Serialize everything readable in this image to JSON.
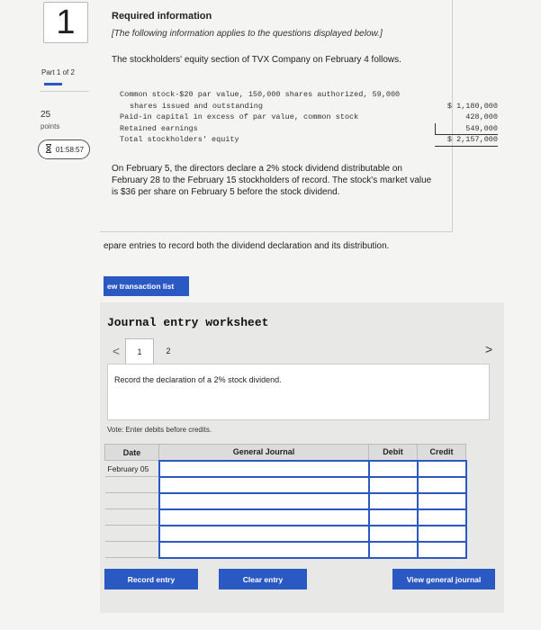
{
  "question": {
    "number": "1",
    "part": "Part 1 of 2",
    "points_value": "25",
    "points_label": "points",
    "timer": "01:58:57"
  },
  "required": {
    "title": "Required information",
    "subtitle": "[The following information applies to the questions displayed below.]",
    "intro": "The stockholders' equity section of TVX Company on February 4 follows."
  },
  "equity": {
    "rows": [
      {
        "label1": "Common stock-$20 par value, 150,000 shares authorized, 59,000",
        "label2": "shares issued and outstanding",
        "amount": "$ 1,180,000"
      },
      {
        "label1": "Paid-in capital in excess of par value, common stock",
        "amount": "428,000"
      },
      {
        "label1": "Retained earnings",
        "amount": "549,000"
      },
      {
        "label1": "Total stockholders' equity",
        "amount": "$ 2,157,000"
      }
    ]
  },
  "scenario": "On February 5, the directors declare a 2% stock dividend distributable on February 28 to the February 15 stockholders of record. The stock's market value is $36 per share on February 5 before the stock dividend.",
  "prepare": "epare entries to record both the dividend declaration and its distribution.",
  "view_transaction": "ew transaction list",
  "worksheet": {
    "title": "Journal entry worksheet",
    "tabs": [
      "1",
      "2"
    ],
    "prev_icon": "<",
    "next_icon": ">",
    "instruction": "Record the declaration of a 2% stock dividend.",
    "note": "Vote: Enter debits before credits.",
    "headers": {
      "date": "Date",
      "journal": "General Journal",
      "debit": "Debit",
      "credit": "Credit"
    },
    "rows": [
      {
        "date": "February 05"
      },
      {
        "date": ""
      },
      {
        "date": ""
      },
      {
        "date": ""
      },
      {
        "date": ""
      },
      {
        "date": ""
      }
    ],
    "buttons": {
      "record": "Record entry",
      "clear": "Clear entry",
      "view_general": "View general journal"
    }
  },
  "colors": {
    "accent": "#2b59c3",
    "panel": "#e8e8e6"
  }
}
